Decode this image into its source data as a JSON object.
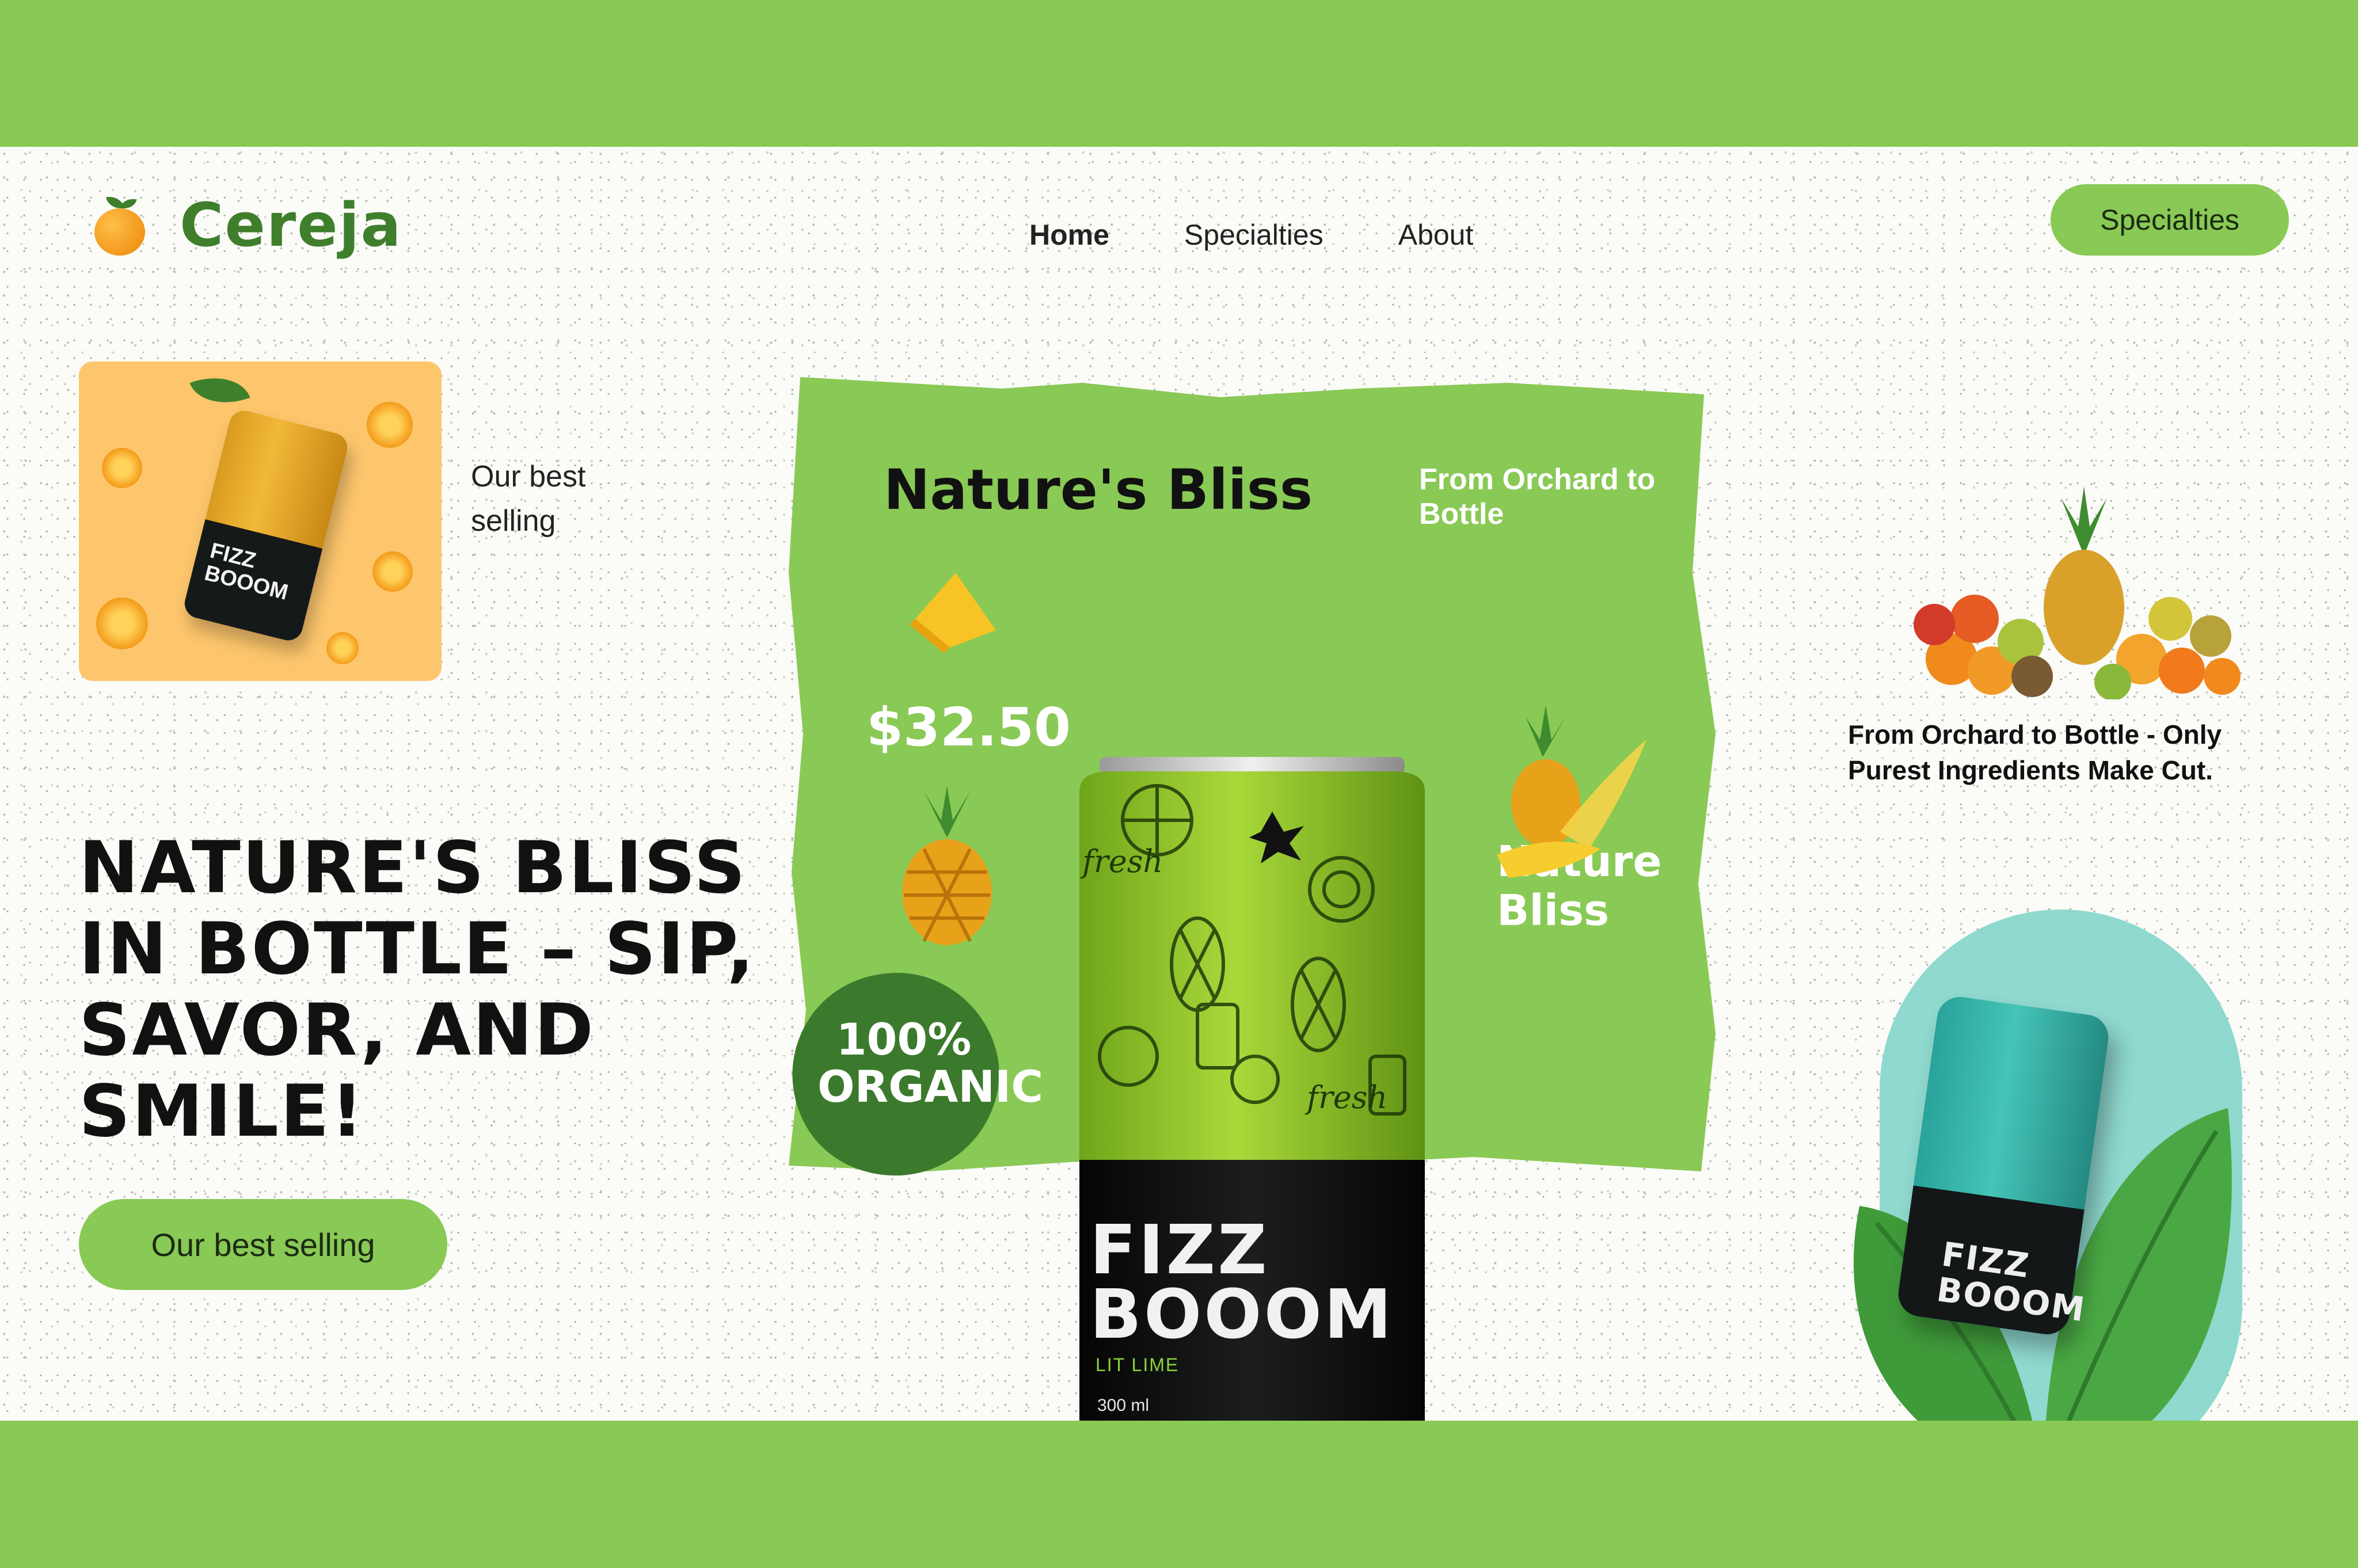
{
  "brand": {
    "name": "Cereja",
    "logo_icon": "orange-fruit-icon"
  },
  "nav": {
    "items": [
      {
        "label": "Home",
        "active": true
      },
      {
        "label": "Specialties",
        "active": false
      },
      {
        "label": "About",
        "active": false
      }
    ]
  },
  "header": {
    "cta_label": "Specialties"
  },
  "left": {
    "card_label": "Our best selling",
    "card_can": {
      "line1": "FIZZ",
      "line2": "BOOOM"
    },
    "hero_title": "NATURE'S BLISS\nIN  BOTTLE – SIP,\nSAVOR, AND\nSMILE!",
    "cta_label": "Our best selling"
  },
  "center": {
    "title": "Nature's Bliss",
    "tagline": "From Orchard to Bottle",
    "price": "$32.50",
    "side_label": "Nature Bliss",
    "badge": "100% ORGANIC",
    "can": {
      "line1": "FIZZ",
      "line2": "BOOOM",
      "flavor": "LIT LIME",
      "volume": "300 ml",
      "pattern_text": "fresh"
    }
  },
  "right": {
    "caption": "From Orchard to Bottle - Only Purest Ingredients Make Cut.",
    "can": {
      "line1": "FIZZ",
      "line2": "BOOOM"
    }
  },
  "colors": {
    "brand_green": "#89c955",
    "dark_green": "#3f7f2c",
    "page_bg": "#fbfbf7",
    "card_orange": "#fdc66d",
    "mint": "#8fd9cf"
  }
}
